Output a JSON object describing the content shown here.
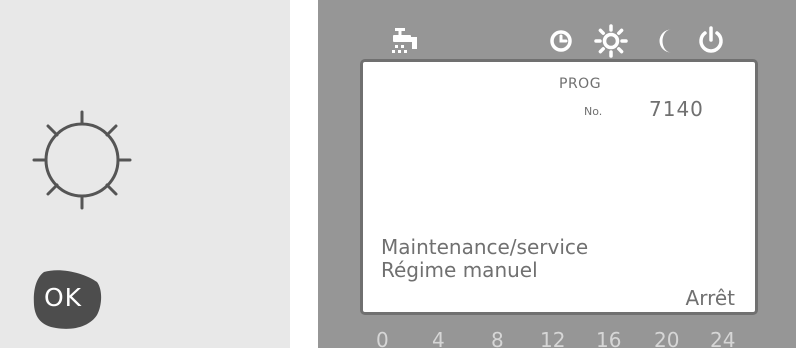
{
  "controls": {
    "ok_label": "OK"
  },
  "display": {
    "prog_title": "PROG",
    "no_label": "No.",
    "program_number": "7140",
    "menu_line_1": "Maintenance/service",
    "menu_line_2": "Régime manuel",
    "value": "Arrêt"
  },
  "time_scale": [
    "0",
    "4",
    "8",
    "12",
    "16",
    "20",
    "24"
  ],
  "status_icons": [
    "tap-icon",
    "clock-icon",
    "sun-icon",
    "moon-icon",
    "power-icon"
  ],
  "colors": {
    "left_panel": "#e8e8e8",
    "right_panel": "#969696",
    "icon": "#ffffff",
    "screen_text": "#707070",
    "ok_button": "#4d4d4d",
    "dial": "#555555"
  }
}
